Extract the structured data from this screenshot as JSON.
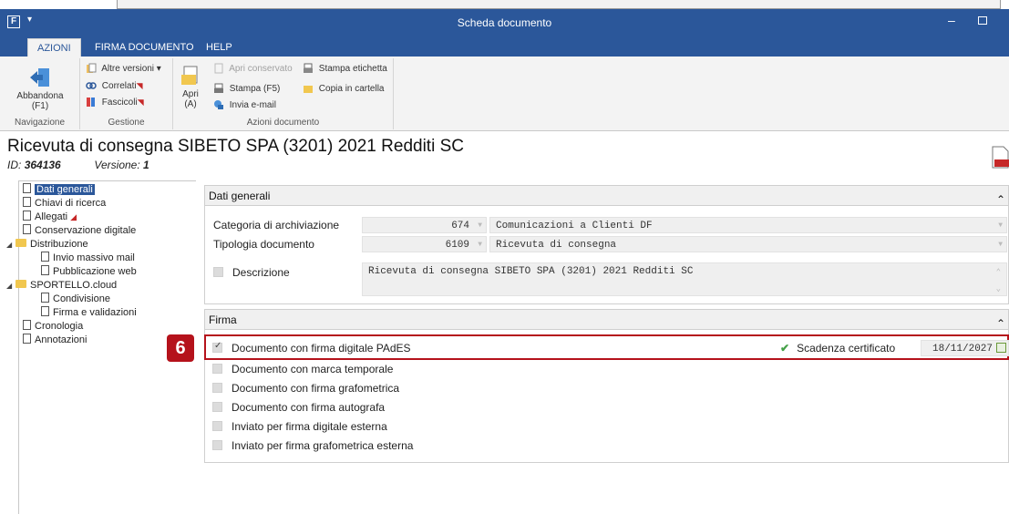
{
  "window": {
    "logo": "F",
    "qat_arrow": "▾",
    "title": "Scheda documento",
    "minimize": "–"
  },
  "ribbon_tabs": [
    "AZIONI",
    "FIRMA DOCUMENTO",
    "HELP"
  ],
  "ribbon": {
    "navigazione": {
      "abbandona_label": "Abbandona",
      "abbandona_key": "(F1)",
      "group": "Navigazione"
    },
    "gestione": {
      "altre_versioni": "Altre versioni ▾",
      "correlati": "Correlati",
      "fascicoli": "Fascicoli",
      "group": "Gestione"
    },
    "azioni_documento": {
      "apri_label": "Apri",
      "apri_key": "(A)",
      "apri_conservato": "Apri conservato",
      "stampa_etichetta": "Stampa etichetta",
      "stampa": "Stampa (F5)",
      "copia_in_cartella": "Copia in cartella",
      "invia_email": "Invia e-mail",
      "group": "Azioni documento"
    }
  },
  "document": {
    "title": "Ricevuta di consegna SIBETO SPA (3201) 2021 Redditi SC",
    "id_label": "ID:",
    "id_value": "364136",
    "version_label": "Versione:",
    "version_value": "1"
  },
  "tree": [
    {
      "label": "Dati generali",
      "type": "file",
      "level": 0,
      "selected": true
    },
    {
      "label": "Chiavi di ricerca",
      "type": "file",
      "level": 0
    },
    {
      "label": "Allegati",
      "type": "file",
      "level": 0,
      "flag": "◢"
    },
    {
      "label": "Conservazione digitale",
      "type": "file",
      "level": 0
    },
    {
      "label": "Distribuzione",
      "type": "folder",
      "level": 0
    },
    {
      "label": "Invio massivo mail",
      "type": "file",
      "level": 1
    },
    {
      "label": "Pubblicazione web",
      "type": "file",
      "level": 1
    },
    {
      "label": "SPORTELLO.cloud",
      "type": "folder",
      "level": 0
    },
    {
      "label": "Condivisione",
      "type": "file",
      "level": 1
    },
    {
      "label": "Firma e validazioni",
      "type": "file",
      "level": 1
    },
    {
      "label": "Cronologia",
      "type": "file",
      "level": 0
    },
    {
      "label": "Annotazioni",
      "type": "file",
      "level": 0
    }
  ],
  "dati_generali": {
    "header": "Dati generali",
    "categoria_label": "Categoria di archiviazione",
    "categoria_code": "674",
    "categoria_value": "Comunicazioni a Clienti DF",
    "tipologia_label": "Tipologia documento",
    "tipologia_code": "6109",
    "tipologia_value": "Ricevuta di consegna",
    "descrizione_label": "Descrizione",
    "descrizione_value": "Ricevuta di consegna SIBETO SPA (3201) 2021 Redditi SC"
  },
  "firma": {
    "header": "Firma",
    "step_number": "6",
    "options": [
      {
        "label": "Documento con firma digitale PAdES",
        "checked": true
      },
      {
        "label": "Documento con marca temporale",
        "checked": false
      },
      {
        "label": "Documento con firma grafometrica",
        "checked": false
      },
      {
        "label": "Documento con firma autografa",
        "checked": false
      },
      {
        "label": "Inviato per firma digitale esterna",
        "checked": false
      },
      {
        "label": "Inviato per firma grafometrica esterna",
        "checked": false
      }
    ],
    "scadenza_label": "Scadenza certificato",
    "scadenza_value": "18/11/2027"
  },
  "colors": {
    "titlebar": "#2b579a",
    "highlight": "#b5121b",
    "ok": "#43a047"
  }
}
